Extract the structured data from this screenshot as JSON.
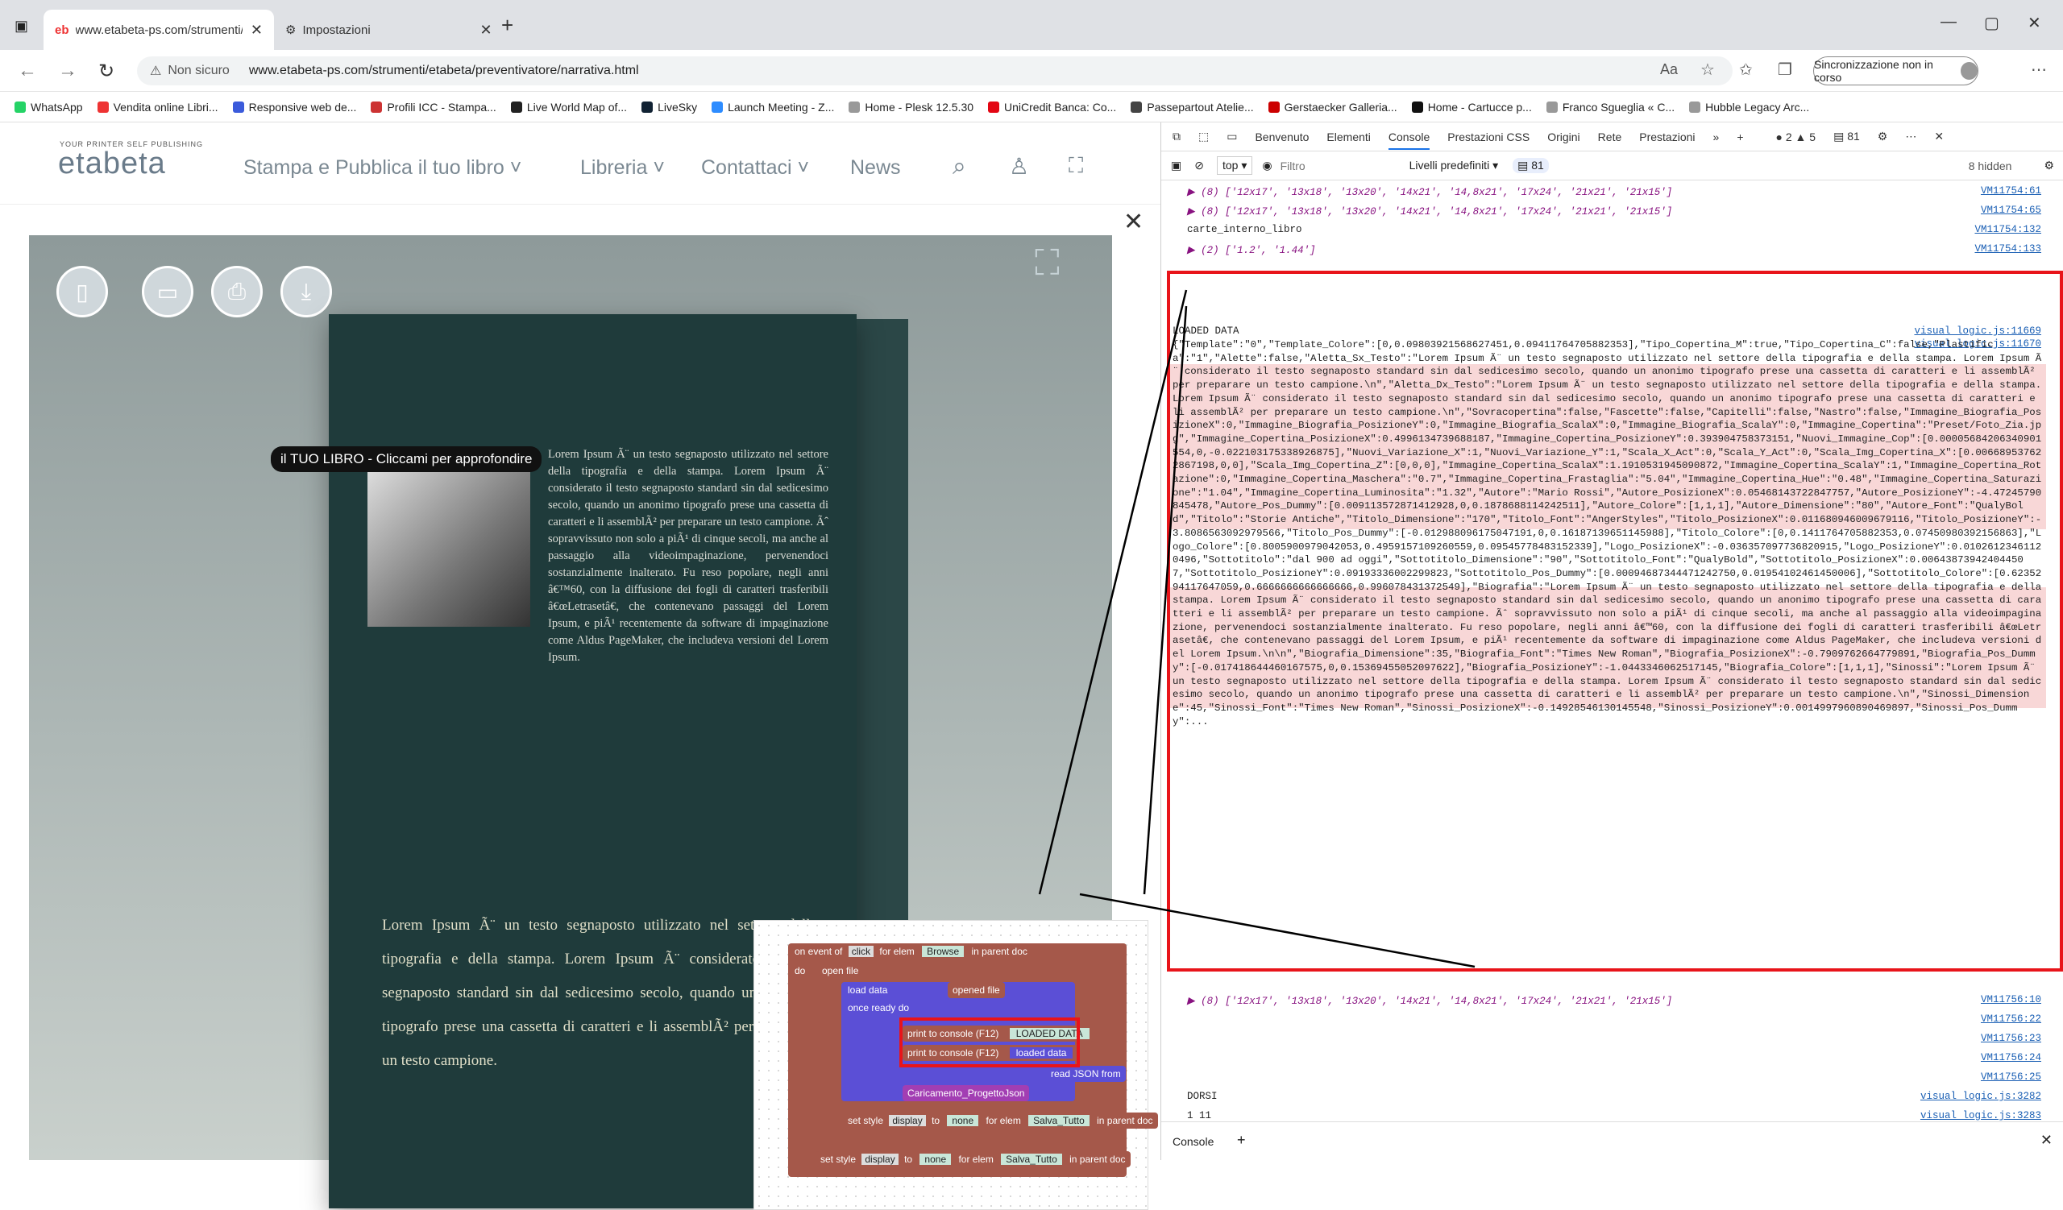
{
  "browser": {
    "tabs": [
      {
        "title": "www.etabeta-ps.com/strumenti/e",
        "active": true
      },
      {
        "title": "Impostazioni",
        "active": false
      }
    ],
    "new_tab": "+",
    "address": {
      "warning": "Non sicuro",
      "url": "www.etabeta-ps.com/strumenti/etabeta/preventivatore/narrativa.html"
    },
    "sync_label": "Sincronizzazione non in corso",
    "bookmarks": [
      {
        "label": "WhatsApp",
        "color": "#25d366"
      },
      {
        "label": "Vendita online Libri...",
        "color": "#e33"
      },
      {
        "label": "Responsive web de...",
        "color": "#3b5bdb"
      },
      {
        "label": "Profili ICC - Stampa...",
        "color": "#c33"
      },
      {
        "label": "Live World Map of...",
        "color": "#222"
      },
      {
        "label": "LiveSky",
        "color": "#123"
      },
      {
        "label": "Launch Meeting - Z...",
        "color": "#2d8cff"
      },
      {
        "label": "Home - Plesk 12.5.30",
        "color": "#999"
      },
      {
        "label": "UniCredit Banca: Co...",
        "color": "#e30613"
      },
      {
        "label": "Passepartout Atelie...",
        "color": "#444"
      },
      {
        "label": "Gerstaecker Galleria...",
        "color": "#c00"
      },
      {
        "label": "Home - Cartucce p...",
        "color": "#111"
      },
      {
        "label": "Franco Sgueglia « C...",
        "color": "#999"
      },
      {
        "label": "Hubble Legacy Arc...",
        "color": "#999"
      }
    ]
  },
  "site": {
    "logo_tagline": "YOUR PRINTER SELF PUBLISHING",
    "logo": "etabeta",
    "nav": [
      "Stampa e Pubblica il tuo libro",
      "Libreria",
      "Contattaci",
      "News"
    ],
    "tooltip": "il TUO LIBRO - Cliccami per approfondire",
    "bio_text": "Lorem Ipsum Ã¨ un testo segnaposto utilizzato nel settore della tipografia e della stampa. Lorem Ipsum Ã¨ considerato il testo segnaposto standard sin dal sedicesimo secolo, quando un anonimo tipografo prese una cassetta di caratteri e li assemblÃ² per preparare un testo campione. Ãˆ sopravvissuto non solo a piÃ¹ di cinque secoli, ma anche al passaggio alla videoimpaginazione, pervenendoci sostanzialmente inalterato. Fu reso popolare, negli anni â€™60, con la diffusione dei fogli di caratteri trasferibili â€œLetrasetâ€, che contenevano passaggi del Lorem Ipsum, e piÃ¹ recentemente da software di impaginazione come Aldus PageMaker, che includeva versioni del Lorem Ipsum.",
    "synopsis_text": "Lorem Ipsum Ã¨ un testo segnaposto utilizzato nel settore della tipografia e della stampa. Lorem Ipsum Ã¨ considerato il testo segnaposto standard sin dal sedicesimo secolo, quando un anonimo tipografo prese una cassetta di caratteri e li assemblÃ² per preparare un testo campione."
  },
  "blockly": {
    "on_event": "on event of",
    "click": "click",
    "for_elem": "for elem",
    "browse": "Browse",
    "in_parent_doc": "in parent doc",
    "do": "do",
    "open_file": "open file",
    "load_data": "load data",
    "opened_file": "opened file",
    "once_ready": "once ready do",
    "print1": "print to console (F12)",
    "loaded_data_lit": "LOADED DATA",
    "print2": "print to console (F12)",
    "loaded_data": "loaded data",
    "read_json": "read JSON from",
    "caricamento": "Caricamento_ProgettoJson",
    "set_style": "set style",
    "display": "display",
    "to": "to",
    "none": "none",
    "salva": "Salva_Tutto"
  },
  "devtools": {
    "tabs": [
      "Benvenuto",
      "Elementi",
      "Console",
      "Prestazioni CSS",
      "Origini",
      "Rete",
      "Prestazioni"
    ],
    "active_tab": "Console",
    "badges": {
      "errors": "2",
      "warnings": "5",
      "messages": "81"
    },
    "filter": {
      "context": "top",
      "placeholder": "Filtro",
      "levels": "Livelli predefiniti",
      "count": "81",
      "hidden": "8 hidden"
    },
    "rows": [
      {
        "text": "▶ (8) ['12x17', '13x18', '13x20', '14x21', '14,8x21', '17x24', '21x21', '21x15']",
        "src": "VM11754:61"
      },
      {
        "text": "▶ (8) ['12x17', '13x18', '13x20', '14x21', '14,8x21', '17x24', '21x21', '21x15']",
        "src": "VM11754:65"
      },
      {
        "text": "carte_interno_libro",
        "src": "VM11754:132"
      },
      {
        "text": "▶ (2) ['1.2', '1.44']",
        "src": "VM11754:133"
      }
    ],
    "loaded_label": "LOADED DATA",
    "loaded_src1": "visual_logic.js:11669",
    "loaded_src2": "visual_logic.js:11670",
    "json_dump": "{\"Template\":\"0\",\"Template_Colore\":[0,0.09803921568627451,0.09411764705882353],\"Tipo_Copertina_M\":true,\"Tipo_Copertina_C\":false,\"Plastifica\":\"1\",\"Alette\":false,\"Aletta_Sx_Testo\":\"Lorem Ipsum Ã¨ un testo segnaposto utilizzato nel settore della tipografia e della stampa. Lorem Ipsum Ã¨ considerato il testo segnaposto standard sin dal sedicesimo secolo, quando un anonimo tipografo prese una cassetta di caratteri e li assemblÃ² per preparare un testo campione.\\n\",\"Aletta_Dx_Testo\":\"Lorem Ipsum Ã¨ un testo segnaposto utilizzato nel settore della tipografia e della stampa. Lorem Ipsum Ã¨ considerato il testo segnaposto standard sin dal sedicesimo secolo, quando un anonimo tipografo prese una cassetta di caratteri e li assemblÃ² per preparare un testo campione.\\n\",\"Sovracopertina\":false,\"Fascette\":false,\"Capitelli\":false,\"Nastro\":false,\"Immagine_Biografia_PosizioneX\":0,\"Immagine_Biografia_PosizioneY\":0,\"Immagine_Biografia_ScalaX\":0,\"Immagine_Biografia_ScalaY\":0,\"Immagine_Copertina\":\"Preset/Foto_Zia.jpg\",\"Immagine_Copertina_PosizioneX\":0.4996134739688187,\"Immagine_Copertina_PosizioneY\":0.393904758373151,\"Nuovi_Immagine_Cop\":[0.00005684206340901554,0,-0.022103175338926875],\"Nuovi_Variazione_X\":1,\"Nuovi_Variazione_Y\":1,\"Scala_X_Act\":0,\"Scala_Y_Act\":0,\"Scala_Img_Copertina_X\":[0.006689537622867198,0,0],\"Scala_Img_Copertina_Z\":[0,0,0],\"Immagine_Copertina_ScalaX\":1.1910531945090872,\"Immagine_Copertina_ScalaY\":1,\"Immagine_Copertina_Rotazione\":0,\"Immagine_Copertina_Maschera\":\"0.7\",\"Immagine_Copertina_Frastaglia\":\"5.04\",\"Immagine_Copertina_Hue\":\"0.48\",\"Immagine_Copertina_Saturazione\":\"1.04\",\"Immagine_Copertina_Luminosita\":\"1.32\",\"Autore\":\"Mario Rossi\",\"Autore_PosizioneX\":0.05468143722847757,\"Autore_PosizioneY\":-4.47245790845478,\"Autore_Pos_Dummy\":[0.009113572871412928,0,0.1878688114242511],\"Autore_Colore\":[1,1,1],\"Autore_Dimensione\":\"80\",\"Autore_Font\":\"QualyBold\",\"Titolo\":\"Storie Antiche\",\"Titolo_Dimensione\":\"170\",\"Titolo_Font\":\"AngerStyles\",\"Titolo_PosizioneX\":0.011680946009679116,\"Titolo_PosizioneY\":-3.8086563092979566,\"Titolo_Pos_Dummy\":[-0.012988096175047191,0,0.16187139651145988],\"Titolo_Colore\":[0,0.1411764705882353,0.07450980392156863],\"Logo_Colore\":[0.8005900979042053,0.4959157109260559,0.09545778483152339],\"Logo_PosizioneX\":-0.036357097736820915,\"Logo_PosizioneY\":0.01026123461120496,\"Sottotitolo\":\"dal 900 ad oggi\",\"Sottotitolo_Dimensione\":\"90\",\"Sottotitolo_Font\":\"QualyBold\",\"Sottotitolo_PosizioneX\":0.006438739424044507,\"Sottotitolo_PosizioneY\":0.09193336002299823,\"Sottotitolo_Pos_Dummy\":[0.00094687344471242750,0.01954102461450006],\"Sottotitolo_Colore\":[0.6235294117647059,0.6666666666666666,0.996078431372549],\"Biografia\":\"Lorem Ipsum Ã¨ un testo segnaposto utilizzato nel settore della tipografia e della stampa. Lorem Ipsum Ã¨ considerato il testo segnaposto standard sin dal sedicesimo secolo, quando un anonimo tipografo prese una cassetta di caratteri e li assemblÃ² per preparare un testo campione. Ãˆ sopravvissuto non solo a piÃ¹ di cinque secoli, ma anche al passaggio alla videoimpaginazione, pervenendoci sostanzialmente inalterato. Fu reso popolare, negli anni â€™60, con la diffusione dei fogli di caratteri trasferibili â€œLetrasetâ€, che contenevano passaggi del Lorem Ipsum, e piÃ¹ recentemente da software di impaginazione come Aldus PageMaker, che includeva versioni del Lorem Ipsum.\\n\\n\",\"Biografia_Dimensione\":35,\"Biografia_Font\":\"Times New Roman\",\"Biografia_PosizioneX\":-0.7909762664779891,\"Biografia_Pos_Dummy\":[-0.017418644460167575,0,0.15369455052097622],\"Biografia_PosizioneY\":-1.0443346062517145,\"Biografia_Colore\":[1,1,1],\"Sinossi\":\"Lorem Ipsum Ã¨ un testo segnaposto utilizzato nel settore della tipografia e della stampa. Lorem Ipsum Ã¨ considerato il testo segnaposto standard sin dal sedicesimo secolo, quando un anonimo tipografo prese una cassetta di caratteri e li assemblÃ² per preparare un testo campione.\\n\",\"Sinossi_Dimensione\":45,\"Sinossi_Font\":\"Times New Roman\",\"Sinossi_PosizioneX\":-0.14928546130145548,\"Sinossi_PosizioneY\":0.0014997960890469897,\"Sinossi_Pos_Dummy\":...",
    "rows_after": [
      {
        "text": "▶ (8) ['12x17', '13x18', '13x20', '14x21', '14,8x21', '17x24', '21x21', '21x15']",
        "src": "VM11756:10"
      },
      {
        "text": "",
        "src": "VM11756:22"
      },
      {
        "text": "",
        "src": "VM11756:23"
      },
      {
        "text": "",
        "src": "VM11756:24"
      },
      {
        "text": "",
        "src": "VM11756:25"
      },
      {
        "text": "DORSI",
        "src": "visual_logic.js:3282"
      },
      {
        "text": "1      11",
        "src": "visual_logic.js:3283"
      }
    ],
    "bottom_tab": "Console"
  }
}
